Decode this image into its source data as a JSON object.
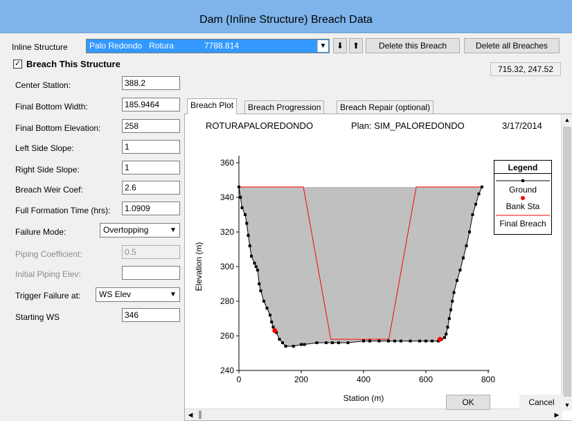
{
  "window": {
    "title": "Dam (Inline Structure) Breach Data"
  },
  "inline_structure": {
    "label": "Inline Structure",
    "river": "Palo Redondo",
    "reach": "Rotura",
    "station": "7788.814",
    "down_arrow": "⬇",
    "up_arrow": "⬆",
    "delete_this": "Delete this Breach",
    "delete_all": "Delete all Breaches"
  },
  "coords_readout": "715.32, 247.52",
  "breach_checkbox": {
    "label": "Breach This Structure",
    "checked": true,
    "mark": "✓"
  },
  "fields": {
    "center_station": {
      "label": "Center Station:",
      "value": "388.2"
    },
    "final_bottom_width": {
      "label": "Final Bottom Width:",
      "value": "185.9464"
    },
    "final_bottom_elevation": {
      "label": "Final Bottom Elevation:",
      "value": "258"
    },
    "left_side_slope": {
      "label": "Left Side Slope:",
      "value": "1"
    },
    "right_side_slope": {
      "label": "Right Side Slope:",
      "value": "1"
    },
    "breach_weir_coef": {
      "label": "Breach Weir Coef:",
      "value": "2.6"
    },
    "full_formation_time": {
      "label": "Full Formation Time (hrs):",
      "value": "1.0909"
    },
    "failure_mode": {
      "label": "Failure Mode:",
      "value": "Overtopping"
    },
    "piping_coefficient": {
      "label": "Piping Coefficient:",
      "value": "0.5"
    },
    "initial_piping_elev": {
      "label": "Initial Piping Elev:",
      "value": ""
    },
    "trigger_failure": {
      "label": "Trigger Failure at:",
      "value": "WS Elev"
    },
    "starting_ws": {
      "label": "Starting WS",
      "value": "346"
    }
  },
  "tabs": [
    {
      "label": "Breach Plot",
      "active": true
    },
    {
      "label": "Breach Progression",
      "active": false
    },
    {
      "label": "Breach Repair (optional)",
      "active": false
    }
  ],
  "plot_header": {
    "project": "ROTURAPALOREDONDO",
    "plan": "Plan: SIM_PALOREDONDO",
    "date": "3/17/2014"
  },
  "buttons": {
    "ok": "OK",
    "cancel": "Cancel"
  },
  "icons": {
    "combo_arrow": "▼",
    "scroll_up": "▲",
    "scroll_down": "▼",
    "scroll_left": "◀",
    "scroll_right": "▶"
  },
  "colors": {
    "fill": "#c0c0c0",
    "breach": "#ff0000",
    "ground": "#000000",
    "bank": "#ff0000",
    "titlebar": "#7eb4ea"
  },
  "chart_data": {
    "type": "line",
    "xlabel": "Station (m)",
    "ylabel": "Elevation (m)",
    "xlim": [
      0,
      800
    ],
    "ylim": [
      240,
      360
    ],
    "xticks": [
      0,
      200,
      400,
      600,
      800
    ],
    "yticks": [
      240,
      260,
      280,
      300,
      320,
      340,
      360
    ],
    "legend": {
      "title": "Legend",
      "entries": [
        "Ground",
        "Bank Sta",
        "Final Breach"
      ],
      "placement": "right"
    },
    "series": [
      {
        "name": "Ground",
        "x": [
          0,
          5,
          10,
          20,
          25,
          30,
          35,
          40,
          50,
          55,
          60,
          65,
          70,
          80,
          90,
          100,
          105,
          110,
          120,
          130,
          140,
          150,
          175,
          200,
          210,
          250,
          280,
          300,
          320,
          350,
          400,
          420,
          450,
          480,
          500,
          520,
          550,
          580,
          600,
          620,
          640,
          650,
          660,
          665,
          670,
          675,
          680,
          685,
          690,
          700,
          710,
          720,
          730,
          740,
          750,
          760,
          770,
          780
        ],
        "y": [
          346,
          340,
          334,
          330,
          325,
          318,
          312,
          306,
          302,
          300,
          298,
          290,
          286,
          280,
          276,
          272,
          268,
          265,
          262,
          258,
          256,
          254,
          254,
          255,
          255,
          256,
          256,
          256,
          256,
          256,
          257,
          257,
          257,
          257,
          257,
          257,
          257,
          257,
          257,
          257,
          257,
          258,
          259,
          261,
          265,
          270,
          275,
          280,
          285,
          292,
          298,
          305,
          312,
          320,
          330,
          336,
          342,
          346
        ]
      },
      {
        "name": "Bank Sta",
        "x": [
          115,
          645
        ],
        "y": [
          263,
          258
        ]
      },
      {
        "name": "Final Breach",
        "x": [
          0,
          207,
          295,
          481,
          569,
          780
        ],
        "y": [
          346,
          346,
          258,
          258,
          346,
          346
        ]
      }
    ]
  }
}
